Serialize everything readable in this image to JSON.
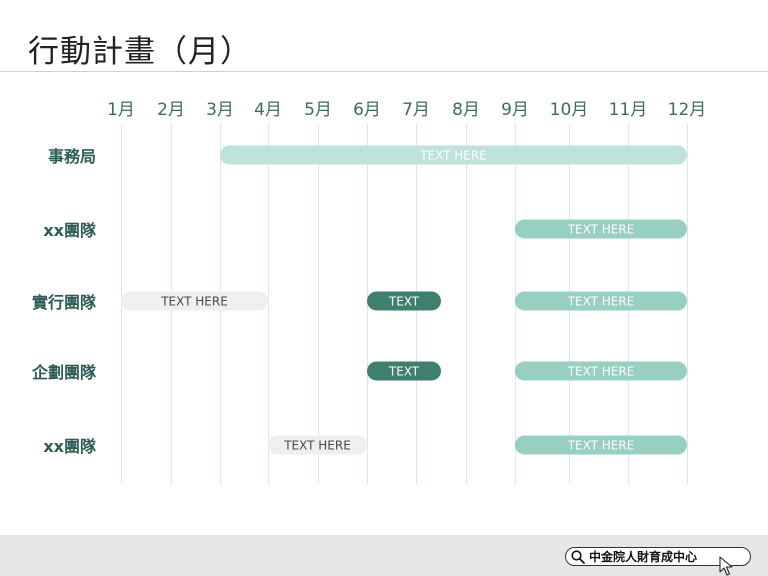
{
  "title": "行動計畫（月）",
  "chart_data": {
    "type": "gantt",
    "months": [
      "1月",
      "2月",
      "3月",
      "4月",
      "5月",
      "6月",
      "7月",
      "8月",
      "9月",
      "10月",
      "11月",
      "12月"
    ],
    "rows": [
      {
        "label": "事務局",
        "bars": [
          {
            "start": 3,
            "end": 12,
            "text": "TEXT HERE",
            "color": "light"
          }
        ]
      },
      {
        "label": "xx團隊",
        "bars": [
          {
            "start": 9,
            "end": 12,
            "text": "TEXT HERE",
            "color": "mid"
          }
        ]
      },
      {
        "label": "實行團隊",
        "bars": [
          {
            "start": 1,
            "end": 4,
            "text": "TEXT HERE",
            "color": "grey"
          },
          {
            "start": 6,
            "end": 7.5,
            "text": "TEXT",
            "color": "dark"
          },
          {
            "start": 9,
            "end": 12,
            "text": "TEXT HERE",
            "color": "mid"
          }
        ]
      },
      {
        "label": "企劃團隊",
        "bars": [
          {
            "start": 6,
            "end": 7.5,
            "text": "TEXT",
            "color": "dark"
          },
          {
            "start": 9,
            "end": 12,
            "text": "TEXT HERE",
            "color": "mid"
          }
        ]
      },
      {
        "label": "xx團隊",
        "bars": [
          {
            "start": 4,
            "end": 6,
            "text": "TEXT HERE",
            "color": "grey"
          },
          {
            "start": 9,
            "end": 12,
            "text": "TEXT HERE",
            "color": "mid"
          }
        ]
      }
    ],
    "colors": {
      "light": "#bfe2da",
      "mid": "#98cfc3",
      "dark": "#3f7f70",
      "grey": "#efefef"
    }
  },
  "footer": {
    "search_text": "中金院人財育成中心"
  }
}
